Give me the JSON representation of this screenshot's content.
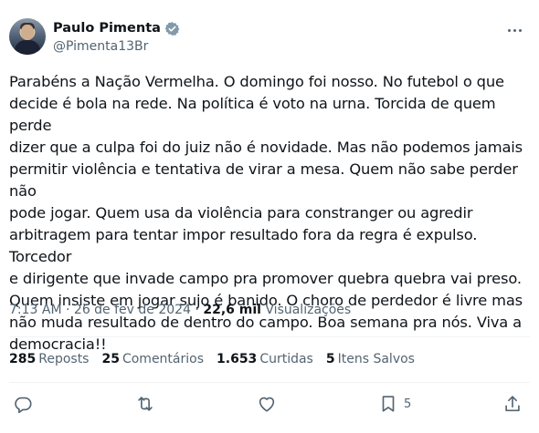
{
  "author": {
    "display_name": "Paulo Pimenta",
    "handle": "@Pimenta13Br",
    "verified_color": "#829aab"
  },
  "post": {
    "text": "Parabéns a Nação Vermelha. O domingo foi nosso. No futebol o que\ndecide é bola na rede. Na política é voto na urna. Torcida de quem perde\ndizer que a culpa foi do juiz não é novidade. Mas não podemos jamais\npermitir violência e tentativa de virar a mesa. Quem não sabe perder não\npode jogar. Quem usa da violência para constranger ou agredir\narbitragem para tentar impor resultado fora da regra é expulso. Torcedor\ne dirigente que invade campo pra promover quebra quebra vai preso.\nQuem insiste em jogar sujo é banido. O choro de perdedor é livre mas\nnão muda resultado de dentro do campo. Boa semana pra nós. Viva a\ndemocracia!!",
    "time": "7:13 AM",
    "separator": "·",
    "date": "26 de fev de 2024",
    "views_count": "22,6 mil",
    "views_label": "Visualizações"
  },
  "stats": [
    {
      "count": "285",
      "label": "Reposts"
    },
    {
      "count": "25",
      "label": "Comentários"
    },
    {
      "count": "1.653",
      "label": "Curtidas"
    },
    {
      "count": "5",
      "label": "Itens Salvos"
    }
  ],
  "actions": {
    "reply_icon": "reply-icon",
    "repost_icon": "repost-icon",
    "like_icon": "heart-icon",
    "bookmark_icon": "bookmark-icon",
    "bookmark_count": "5",
    "share_icon": "share-icon"
  },
  "colors": {
    "text": "#0f1419",
    "secondary": "#536471",
    "divider": "#eff3f4"
  }
}
